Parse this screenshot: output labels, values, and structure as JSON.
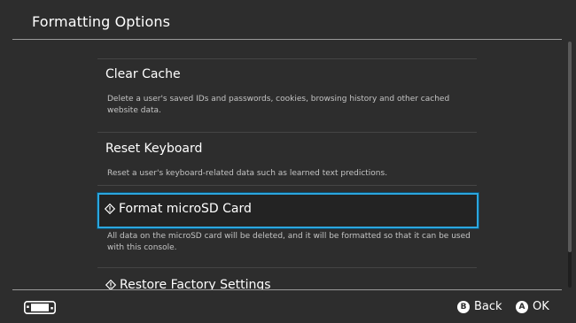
{
  "header": {
    "title": "Formatting Options"
  },
  "items": [
    {
      "title": "Clear Cache",
      "description": "Delete a user's saved IDs and passwords, cookies, browsing history and other cached website data."
    },
    {
      "title": "Reset Keyboard",
      "description": "Reset a user's keyboard-related data such as learned text predictions."
    },
    {
      "title": "Format microSD Card",
      "description": "All data on the microSD card will be deleted, and it will be formatted so that it can be used with this console."
    },
    {
      "title": "Restore Factory Settings"
    }
  ],
  "selected_index": 2,
  "footer": {
    "back": {
      "button": "B",
      "label": "Back"
    },
    "ok": {
      "button": "A",
      "label": "OK"
    }
  },
  "colors": {
    "background": "#2d2d2d",
    "selection_border": "#2ba6de",
    "text": "#ffffff",
    "description": "#c4c4c4"
  },
  "icons": {
    "warning": "diamond-exclamation-icon",
    "console": "handheld-console-icon"
  }
}
